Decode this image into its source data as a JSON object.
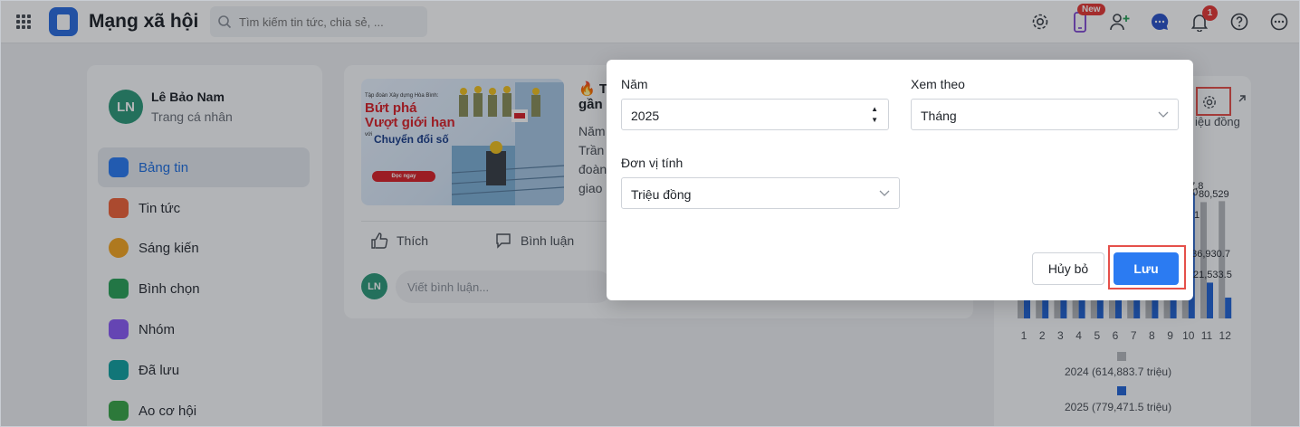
{
  "app": {
    "title": "Mạng xã hội",
    "search_placeholder": "Tìm kiếm tin tức, chia sẻ, ...",
    "new_badge": "New",
    "notification_count": "1"
  },
  "profile": {
    "initials": "LN",
    "name": "Lê Bảo Nam",
    "subtitle": "Trang cá nhân"
  },
  "sidebar": {
    "items": [
      {
        "label": "Bảng tin",
        "icon": "newsfeed-icon",
        "color": "#2b7bf2"
      },
      {
        "label": "Tin tức",
        "icon": "news-icon",
        "color": "#f0643a"
      },
      {
        "label": "Sáng kiến",
        "icon": "lightbulb-icon",
        "color": "#f5a623"
      },
      {
        "label": "Bình chọn",
        "icon": "poll-icon",
        "color": "#2ca35a"
      },
      {
        "label": "Nhóm",
        "icon": "group-icon",
        "color": "#8b5cf6"
      },
      {
        "label": "Đã lưu",
        "icon": "bookmark-icon",
        "color": "#14a3a3"
      },
      {
        "label": "Ao cơ hội",
        "icon": "opportunity-icon",
        "color": "#3aa64a"
      }
    ]
  },
  "post": {
    "banner": {
      "small": "Tập đoàn Xây dựng Hòa Bình:",
      "line1": "Bứt phá",
      "line2": "Vượt giới hạn",
      "with": "với",
      "line3": "Chuyển đổi số",
      "cta": "Đọc ngay"
    },
    "title_line1": "🔥 Tậ",
    "title_line2": "gần",
    "body_lines": [
      "Năm",
      "Trần",
      "đoàn",
      "giao"
    ],
    "like_label": "Thích",
    "comment_label": "Bình luận",
    "comment_placeholder": "Viết bình luận..."
  },
  "stats": {
    "unit_label": "iệu đồng",
    "legend": [
      {
        "label": "2024 (614,883.7 triệu)",
        "color": "#b6b9be"
      },
      {
        "label": "2025 (779,471.5 triệu)",
        "color": "#2466d6"
      }
    ]
  },
  "chart_data": {
    "type": "bar",
    "categories": [
      "1",
      "2",
      "3",
      "4",
      "5",
      "6",
      "7",
      "8",
      "9",
      "10",
      "11",
      "12"
    ],
    "series": [
      {
        "name": "2024 (614,883.7 triệu)",
        "values": [
          45000,
          44000,
          46000,
          44500,
          45500,
          44000,
          46500,
          45000,
          47000,
          62000,
          120000,
          121000
        ]
      },
      {
        "name": "2025 (779,471.5 triệu)",
        "values": [
          42000,
          43000,
          44000,
          42500,
          43500,
          44000,
          45000,
          46000,
          47000,
          130000,
          36930.7,
          21533.5
        ]
      }
    ],
    "data_labels_visible": [
      "37.8",
      "3,0",
      "80,529",
      ".1",
      "136,930.7",
      "21,533.5"
    ],
    "colors": {
      "2024": "#b6b9be",
      "2025": "#2466d6"
    }
  },
  "modal": {
    "year_label": "Năm",
    "year_value": "2025",
    "view_label": "Xem theo",
    "view_value": "Tháng",
    "unit_label": "Đơn vị tính",
    "unit_value": "Triệu đồng",
    "cancel_label": "Hủy bỏ",
    "save_label": "Lưu"
  }
}
